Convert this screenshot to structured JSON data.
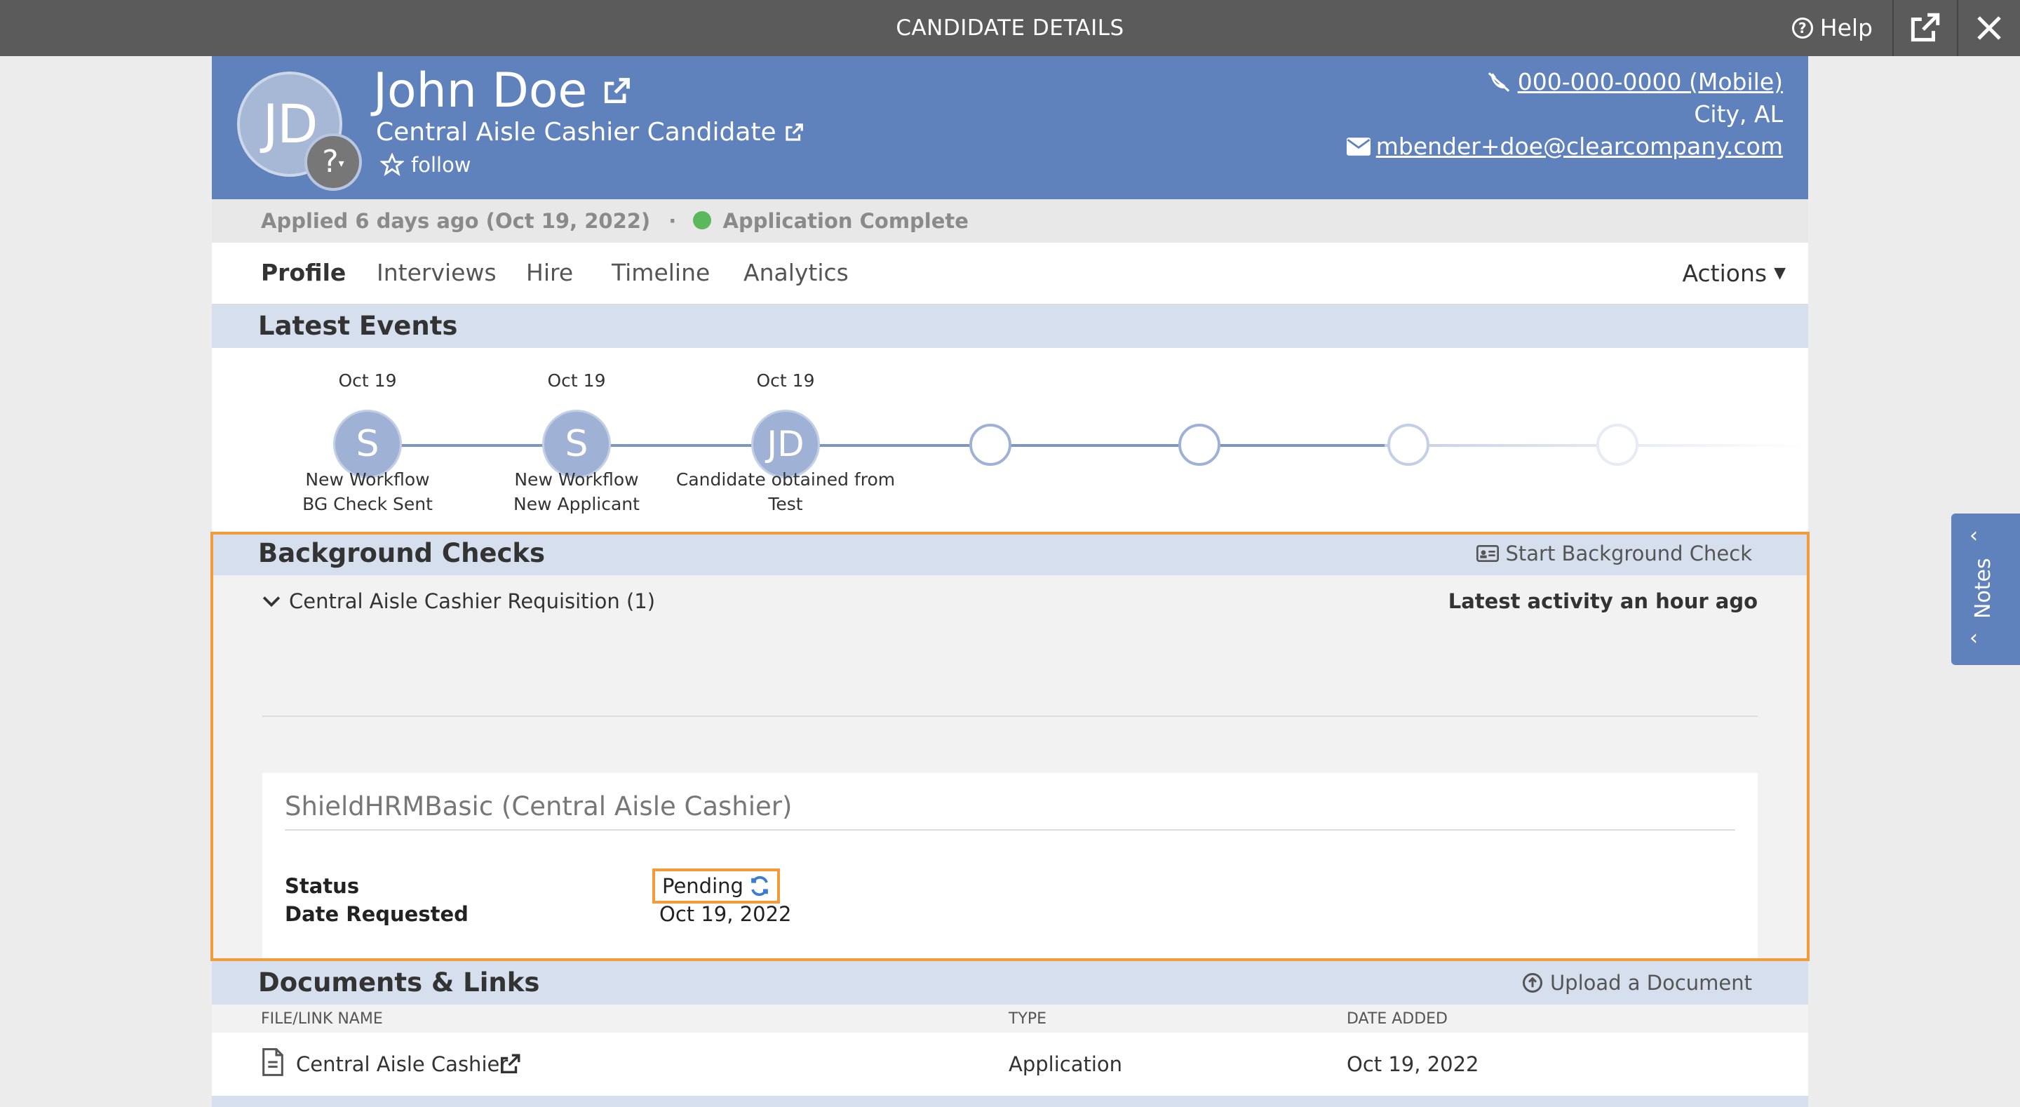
{
  "topbar": {
    "title": "CANDIDATE DETAILS",
    "help_label": "Help"
  },
  "candidate": {
    "initials": "JD",
    "badge": "?",
    "name": "John Doe",
    "job": "Central Aisle Cashier Candidate",
    "follow_label": "follow",
    "phone": "000-000-0000 (Mobile)",
    "location": "City, AL",
    "email": "mbender+doe@clearcompany.com"
  },
  "status_bar": {
    "applied": "Applied 6 days ago (Oct 19, 2022)",
    "separator": "·",
    "status": "Application Complete",
    "status_color": "#5cb85c"
  },
  "tabs": [
    {
      "label": "Profile",
      "active": true
    },
    {
      "label": "Interviews"
    },
    {
      "label": "Hire"
    },
    {
      "label": "Timeline"
    },
    {
      "label": "Analytics"
    }
  ],
  "actions_label": "Actions",
  "latest_events": {
    "title": "Latest Events",
    "events": [
      {
        "date": "Oct 19",
        "initials": "S",
        "line1": "New Workflow",
        "line2": "BG Check Sent"
      },
      {
        "date": "Oct 19",
        "initials": "S",
        "line1": "New Workflow",
        "line2": "New Applicant"
      },
      {
        "date": "Oct 19",
        "initials": "JD",
        "line1": "Candidate obtained from",
        "line2": "Test"
      }
    ]
  },
  "background_checks": {
    "title": "Background Checks",
    "start_label": "Start Background Check",
    "requisition": "Central Aisle Cashier Requisition (1)",
    "latest_activity": "Latest activity an hour ago",
    "check_title": "ShieldHRMBasic (Central Aisle Cashier)",
    "status_label": "Status",
    "status_value": "Pending",
    "date_label": "Date Requested",
    "date_value": "Oct 19, 2022"
  },
  "documents": {
    "title": "Documents & Links",
    "upload_label": "Upload a Document",
    "columns": [
      "FILE/LINK NAME",
      "TYPE",
      "DATE ADDED"
    ],
    "rows": [
      {
        "name": "Central Aisle Cashier",
        "type": "Application",
        "date": "Oct 19, 2022"
      }
    ]
  },
  "notes_label": "Notes",
  "colors": {
    "header": "#5f82bd",
    "highlight": "#f29b38",
    "section": "#d5dfed"
  }
}
